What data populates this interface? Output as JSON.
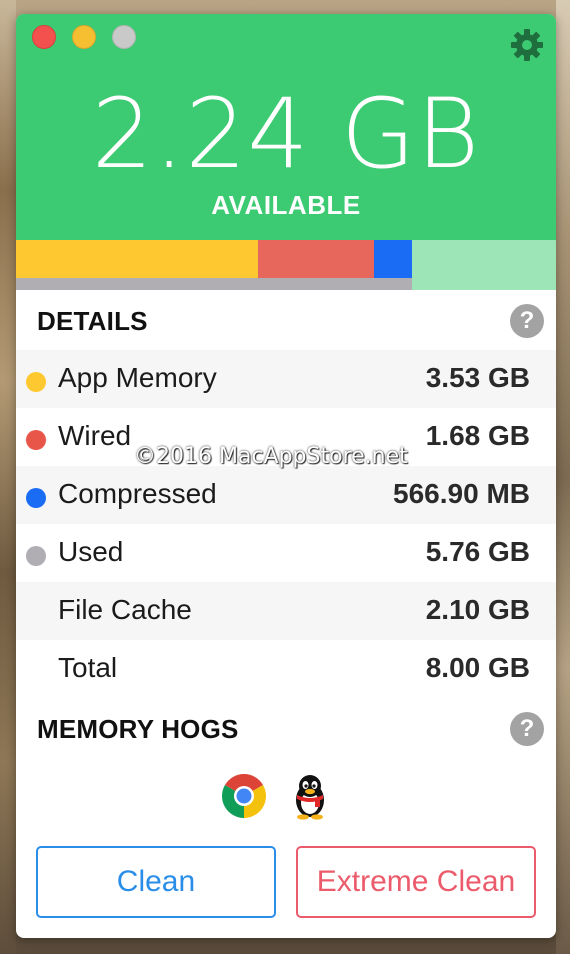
{
  "window": {
    "traffic_lights": [
      "close",
      "minimize",
      "zoom"
    ],
    "settings_icon": "gear-icon"
  },
  "summary": {
    "available_value": "2.24 GB",
    "available_label": "AVAILABLE"
  },
  "usage_bar": {
    "segments": [
      {
        "name": "App Memory",
        "gb": 3.53,
        "color": "#fec930"
      },
      {
        "name": "Wired",
        "gb": 1.68,
        "color": "#e8675d"
      },
      {
        "name": "Compressed",
        "gb": 0.57,
        "color": "#1a6cf5"
      },
      {
        "name": "Available",
        "gb": 2.24,
        "color": "#9de4b7"
      }
    ],
    "used_gb": 5.76,
    "total_gb": 8.0,
    "used_color": "#b0aeb3"
  },
  "details": {
    "title": "DETAILS",
    "help_icon": "?",
    "rows": [
      {
        "label": "App Memory",
        "value": "3.53 GB",
        "dot_color": "#fec930"
      },
      {
        "label": "Wired",
        "value": "1.68 GB",
        "dot_color": "#e8675d"
      },
      {
        "label": "Compressed",
        "value": "566.90 MB",
        "dot_color": "#1a6cf5"
      },
      {
        "label": "Used",
        "value": "5.76 GB",
        "dot_color": "#b0aeb3"
      },
      {
        "label": "File Cache",
        "value": "2.10 GB"
      },
      {
        "label": "Total",
        "value": "8.00 GB"
      }
    ]
  },
  "memory_hogs": {
    "title": "MEMORY HOGS",
    "help_icon": "?",
    "apps": [
      "chrome-icon",
      "qq-penguin-icon"
    ]
  },
  "buttons": {
    "clean": "Clean",
    "extreme_clean": "Extreme Clean"
  },
  "watermark": "©2016 MacAppStore.net",
  "colors": {
    "header_green": "#3cca72",
    "clean_blue": "#2a8ee8",
    "extreme_red": "#ec5b6b"
  }
}
